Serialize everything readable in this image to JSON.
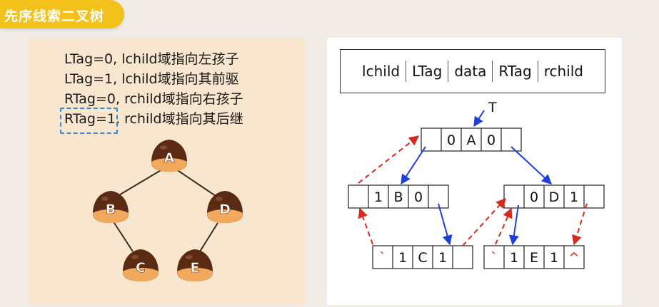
{
  "header": {
    "title": "先序线索二叉树"
  },
  "rules": [
    "LTag=0, lchild域指向左孩子",
    "LTag=1, lchild域指向其前驱",
    "RTag=0, rchild域指向右孩子"
  ],
  "rule_last": {
    "highlight": "RTag=1",
    "rest": ", rchild域指向其后继"
  },
  "tree": {
    "A": "A",
    "B": "B",
    "C": "C",
    "D": "D",
    "E": "E"
  },
  "node_format": [
    "lchild",
    "LTag",
    "data",
    "RTag",
    "rchild"
  ],
  "pointer_label": "T",
  "threaded_nodes": {
    "A": {
      "ltag": "0",
      "data": "A",
      "rtag": "0",
      "lptr": "",
      "rptr": ""
    },
    "B": {
      "ltag": "1",
      "data": "B",
      "rtag": "0",
      "lptr": "",
      "rptr": ""
    },
    "D": {
      "ltag": "0",
      "data": "D",
      "rtag": "1",
      "lptr": "",
      "rptr": ""
    },
    "C": {
      "ltag": "1",
      "data": "C",
      "rtag": "1",
      "lptr": "`",
      "rptr": ""
    },
    "E": {
      "ltag": "1",
      "data": "E",
      "rtag": "1",
      "lptr": "`",
      "rptr": "^"
    }
  },
  "colors": {
    "badge": "#f2c21a",
    "left_panel": "#f9e6cf",
    "chestnut_top": "#5a2a12",
    "chestnut_bottom": "#f2a95c",
    "tree_edge": "#3a2a1e",
    "child_pointer": "#1f3fd8",
    "thread_pointer": "#d62a1e",
    "highlight_box": "#3a86d6"
  }
}
